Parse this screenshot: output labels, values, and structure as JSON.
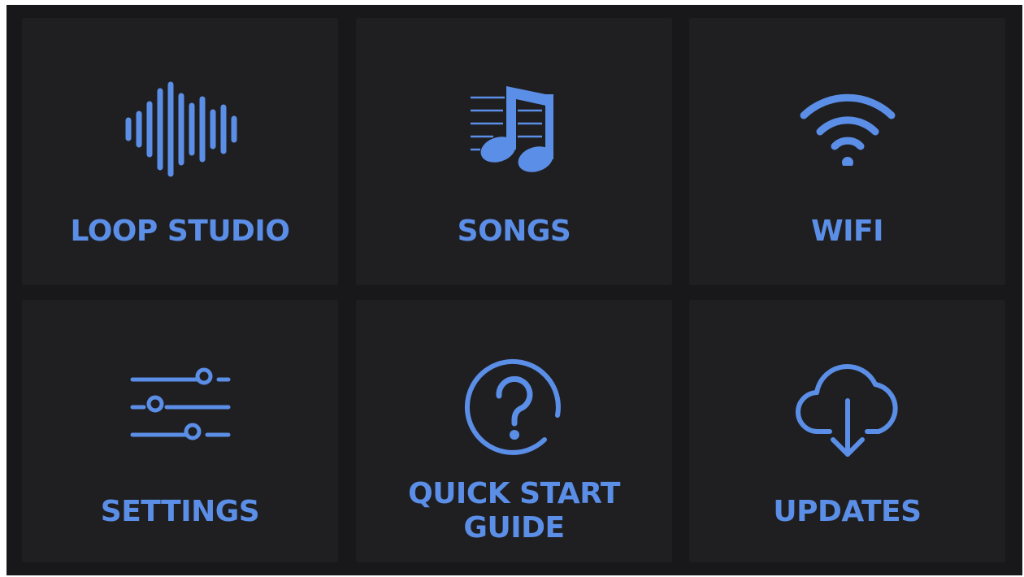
{
  "menu": {
    "tiles": [
      {
        "label": "LOOP STUDIO",
        "icon": "waveform-icon"
      },
      {
        "label": "SONGS",
        "icon": "music-notes-icon"
      },
      {
        "label": "WIFI",
        "icon": "wifi-icon"
      },
      {
        "label": "SETTINGS",
        "icon": "sliders-icon"
      },
      {
        "label_lines": [
          "QUICK START",
          "GUIDE"
        ],
        "icon": "help-circle-icon"
      },
      {
        "label": "UPDATES",
        "icon": "cloud-download-icon"
      }
    ]
  },
  "colors": {
    "accent": "#5b8ee6",
    "background": "#18181b",
    "tile": "#1f1f22"
  }
}
